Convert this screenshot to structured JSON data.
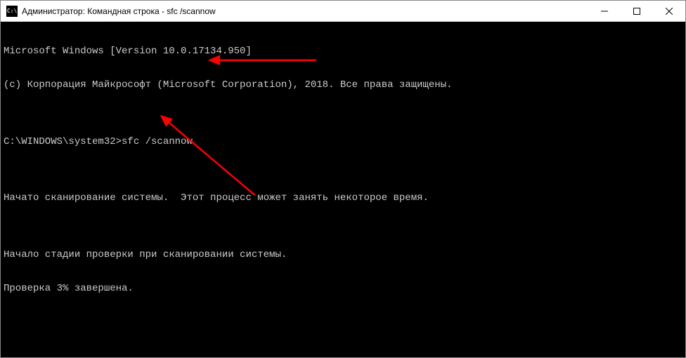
{
  "titlebar": {
    "icon_text": "C:\\",
    "title": "Администратор: Командная строка - sfc  /scannow"
  },
  "terminal": {
    "lines": [
      "Microsoft Windows [Version 10.0.17134.950]",
      "(c) Корпорация Майкрософт (Microsoft Corporation), 2018. Все права защищены.",
      "",
      "C:\\WINDOWS\\system32>sfc /scannow",
      "",
      "Начато сканирование системы.  Этот процесс может занять некоторое время.",
      "",
      "Начало стадии проверки при сканировании системы.",
      "Проверка 3% завершена."
    ]
  },
  "annotations": {
    "arrow_color": "#ff0000"
  }
}
